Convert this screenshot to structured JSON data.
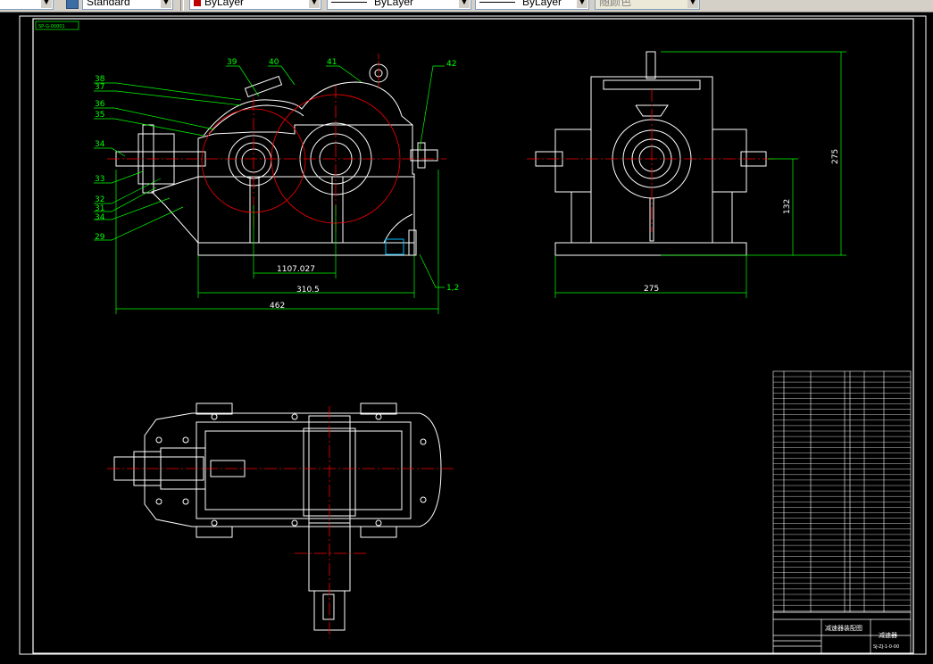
{
  "toolbar": {
    "textstyle_value": "Standard",
    "layer_value": "ByLayer",
    "linetype_value": "ByLayer",
    "lineweight_value": "ByLayer",
    "plotstyle_value": "随颜色"
  },
  "drawing": {
    "corner_tag": "SP-G-00001",
    "balloons": {
      "b39": "39",
      "b40": "40",
      "b41": "41",
      "b42": "42",
      "b38": "38",
      "b37": "37",
      "b36": "36",
      "b35": "35",
      "b34a": "34",
      "b33": "33",
      "b32": "32",
      "b31": "31",
      "b34b": "34",
      "b29": "29",
      "b12": "1,2"
    },
    "dimensions": {
      "d_center": "1107.027",
      "d_base": "310.5",
      "d_total": "462",
      "d_side_width": "275",
      "d_side_height": "275",
      "d_side_axis": "132"
    },
    "title_block": {
      "drawing_name": "减速器装配图",
      "company": "减速器",
      "code": "SJ-ZJ-1-0-00"
    }
  },
  "colors": {
    "background": "#000000",
    "line_white": "#ffffff",
    "centerline_red": "#ff0000",
    "balloon_green": "#00ff00",
    "dimension_green": "#00ff00"
  }
}
